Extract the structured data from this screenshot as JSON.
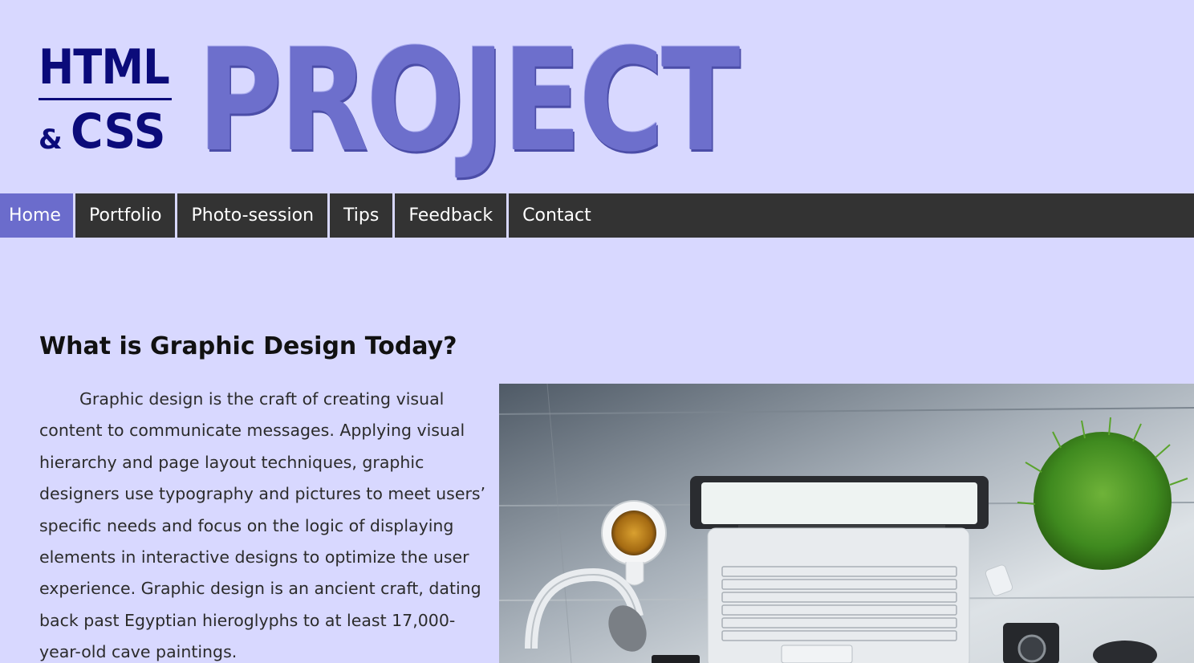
{
  "logo": {
    "html_text": "HTML",
    "amp_text": "&",
    "css_text": "CSS",
    "project_text": "PROJECT"
  },
  "nav": {
    "items": [
      {
        "label": "Home",
        "active": true
      },
      {
        "label": "Portfolio",
        "active": false
      },
      {
        "label": "Photo-session",
        "active": false
      },
      {
        "label": "Tips",
        "active": false
      },
      {
        "label": "Feedback",
        "active": false
      },
      {
        "label": "Contact",
        "active": false
      }
    ]
  },
  "main": {
    "heading": "What is Graphic Design Today?",
    "paragraph": "Graphic design is the craft of creating visual content to communicate messages. Applying visual hierarchy and page layout techniques, graphic designers use typography and pictures to meet users’ specific needs and focus on the logic of displaying elements in interactive designs to optimize the user experience. Graphic design is an ancient craft, dating back past Egyptian hieroglyphs to at least 17,000-year-old cave paintings."
  },
  "colors": {
    "page_background": "#d8d8ff",
    "nav_background": "#333333",
    "nav_active": "#6b6ccc",
    "logo_dark": "#0b0b7a",
    "logo_project": "#6d6fcc"
  }
}
